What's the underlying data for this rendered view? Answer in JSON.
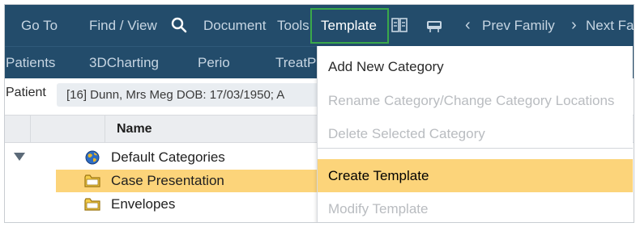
{
  "menubar": {
    "goto": "Go To",
    "find_view": "Find / View",
    "document": "Document",
    "tools": "Tools",
    "template": "Template",
    "prev_family": "Prev Family",
    "next_family": "Next Fa",
    "chevron_left": "‹",
    "chevron_right": "›"
  },
  "subbar": {
    "patients": "Patients",
    "charting": "3DCharting",
    "perio": "Perio",
    "treat": "TreatP"
  },
  "patient": {
    "label": "Patient",
    "value": "[16] Dunn, Mrs Meg DOB: 17/03/1950; A"
  },
  "grid": {
    "name_header": "Name",
    "rows": [
      {
        "label": "Default Categories",
        "icon": "globe-icon"
      },
      {
        "label": "Case Presentation",
        "icon": "folder-icon"
      },
      {
        "label": "Envelopes",
        "icon": "folder-icon"
      }
    ]
  },
  "dropdown": {
    "items": [
      {
        "label": "Add New Category",
        "state": "enabled"
      },
      {
        "label": "Rename Category/Change Category Locations",
        "state": "disabled"
      },
      {
        "label": "Delete Selected Category",
        "state": "disabled"
      },
      {
        "label": "Create Template",
        "state": "hover"
      },
      {
        "label": "Modify Template",
        "state": "disabled"
      }
    ]
  },
  "colors": {
    "nav_bg": "#234c6b",
    "nav_text": "#c6d5e2",
    "active_outline": "#3aa84a",
    "highlight": "#fcd47a"
  }
}
